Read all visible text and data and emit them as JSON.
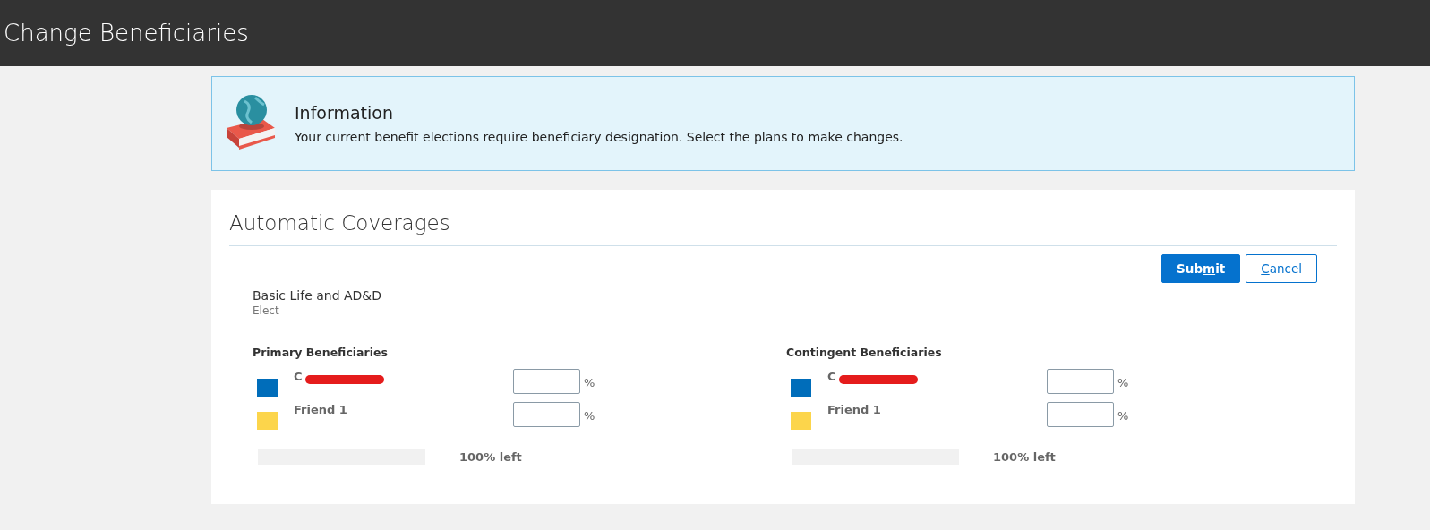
{
  "header": {
    "title": "Change Beneficiaries"
  },
  "info": {
    "title": "Information",
    "message": "Your current benefit elections require beneficiary designation. Select the plans to make changes."
  },
  "section": {
    "title": "Automatic Coverages",
    "buttons": [
      {
        "kind": "primary",
        "before": "Sub",
        "access_key": "m",
        "after": "it"
      },
      {
        "kind": "secondary",
        "access_key": "C",
        "after": "ancel"
      }
    ],
    "plan": {
      "name": "Basic Life and AD&D",
      "status": "Elect"
    },
    "groups": [
      {
        "title": "Primary Beneficiaries",
        "beneficiaries": [
          {
            "name": "C",
            "color": "#006dba",
            "redacted": true
          },
          {
            "name": "Friend 1",
            "color": "#fcd54b",
            "redacted": false
          }
        ],
        "percent_sign": "%",
        "allocation": {
          "level": 0,
          "reading": "100% left"
        }
      },
      {
        "title": "Contingent Beneficiaries",
        "beneficiaries": [
          {
            "name": "C",
            "color": "#006dba",
            "redacted": true
          },
          {
            "name": "Friend 1",
            "color": "#fcd54b",
            "redacted": false
          }
        ],
        "percent_sign": "%",
        "allocation": {
          "level": 0,
          "reading": "100% left"
        }
      }
    ]
  }
}
